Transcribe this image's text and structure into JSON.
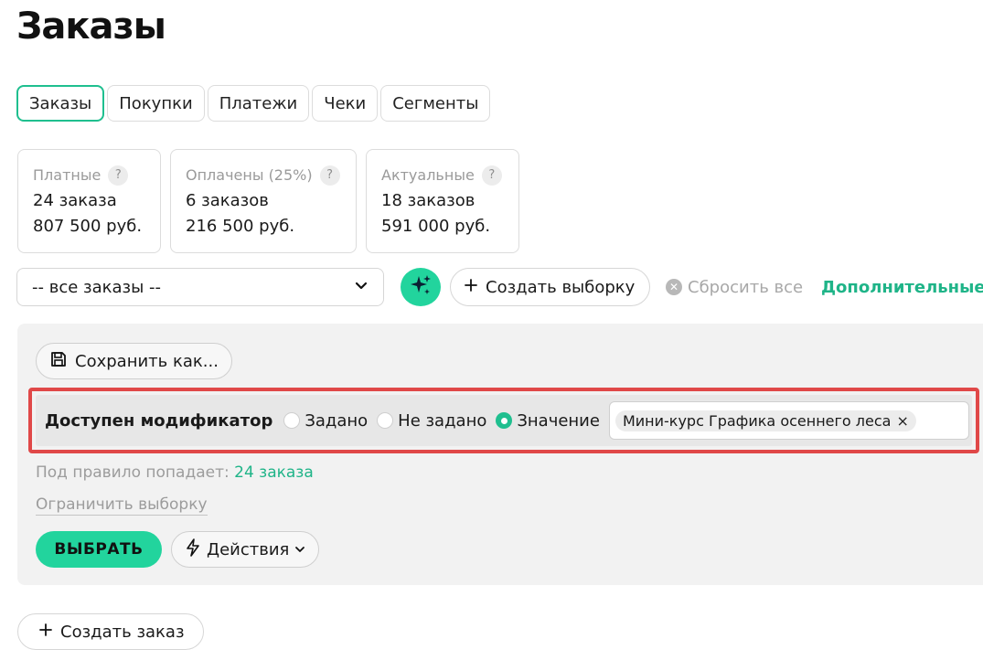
{
  "page": {
    "title": "Заказы"
  },
  "tabs": [
    {
      "label": "Заказы",
      "active": true
    },
    {
      "label": "Покупки"
    },
    {
      "label": "Платежи"
    },
    {
      "label": "Чеки"
    },
    {
      "label": "Сегменты"
    }
  ],
  "stats": [
    {
      "label": "Платные",
      "help": "?",
      "count": "24 заказа",
      "sum": "807 500 руб."
    },
    {
      "label": "Оплачены (25%)",
      "help": "?",
      "count": "6 заказов",
      "sum": "216 500 руб."
    },
    {
      "label": "Актуальные",
      "help": "?",
      "count": "18 заказов",
      "sum": "591 000 руб."
    }
  ],
  "toolbar": {
    "filter_value": "-- все заказы --",
    "ai_icon": "sparkles-icon",
    "create_selection": "Создать выборку",
    "reset_all": "Сбросить все",
    "more": "Дополнительные п"
  },
  "panel": {
    "save_as": "Сохранить как...",
    "rule": {
      "label": "Доступен модификатор",
      "options": [
        "Задано",
        "Не задано",
        "Значение"
      ],
      "selected": "Значение",
      "chip": "Мини-курс Графика осеннего леса",
      "chip_remove": "×"
    },
    "match_prefix": "Под правило попадает:",
    "match_count": "24 заказа",
    "limit": "Ограничить выборку",
    "select": "ВЫБРАТЬ",
    "actions": "Действия"
  },
  "footer": {
    "create_order": "Создать заказ"
  },
  "colors": {
    "accent": "#22d49d",
    "accent_text": "#1fb488",
    "highlight": "#e04848"
  }
}
